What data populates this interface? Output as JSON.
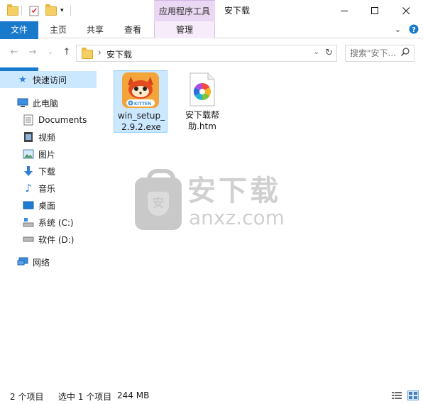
{
  "window": {
    "title": "安下载",
    "tool_tab_header": "应用程序工具"
  },
  "ribbon": {
    "tabs": [
      "文件",
      "主页",
      "共享",
      "查看",
      "管理"
    ]
  },
  "address": {
    "crumb": "安下载",
    "search_placeholder": "搜索\"安下..."
  },
  "nav": {
    "quick_access": "快速访问",
    "this_pc": "此电脑",
    "items": [
      "Documents",
      "视频",
      "图片",
      "下载",
      "音乐",
      "桌面",
      "系统 (C:)",
      "软件 (D:)"
    ],
    "network": "网络"
  },
  "files": [
    {
      "name_line1": "win_setup_",
      "name_line2": "2.9.2.exe",
      "badge": "KITTEN"
    },
    {
      "name_line1": "安下载帮",
      "name_line2": "助.htm"
    }
  ],
  "watermark": {
    "cn": "安下载",
    "en": "anxz.com",
    "shield": "安"
  },
  "status": {
    "count": "2 个项目",
    "selected": "选中 1 个项目",
    "size": "244 MB"
  },
  "colors": {
    "file_tab": "#1979ca",
    "tool_tab": "#ead7f3",
    "selection": "#cce8ff",
    "kitten_brand": "#f3a53a"
  }
}
